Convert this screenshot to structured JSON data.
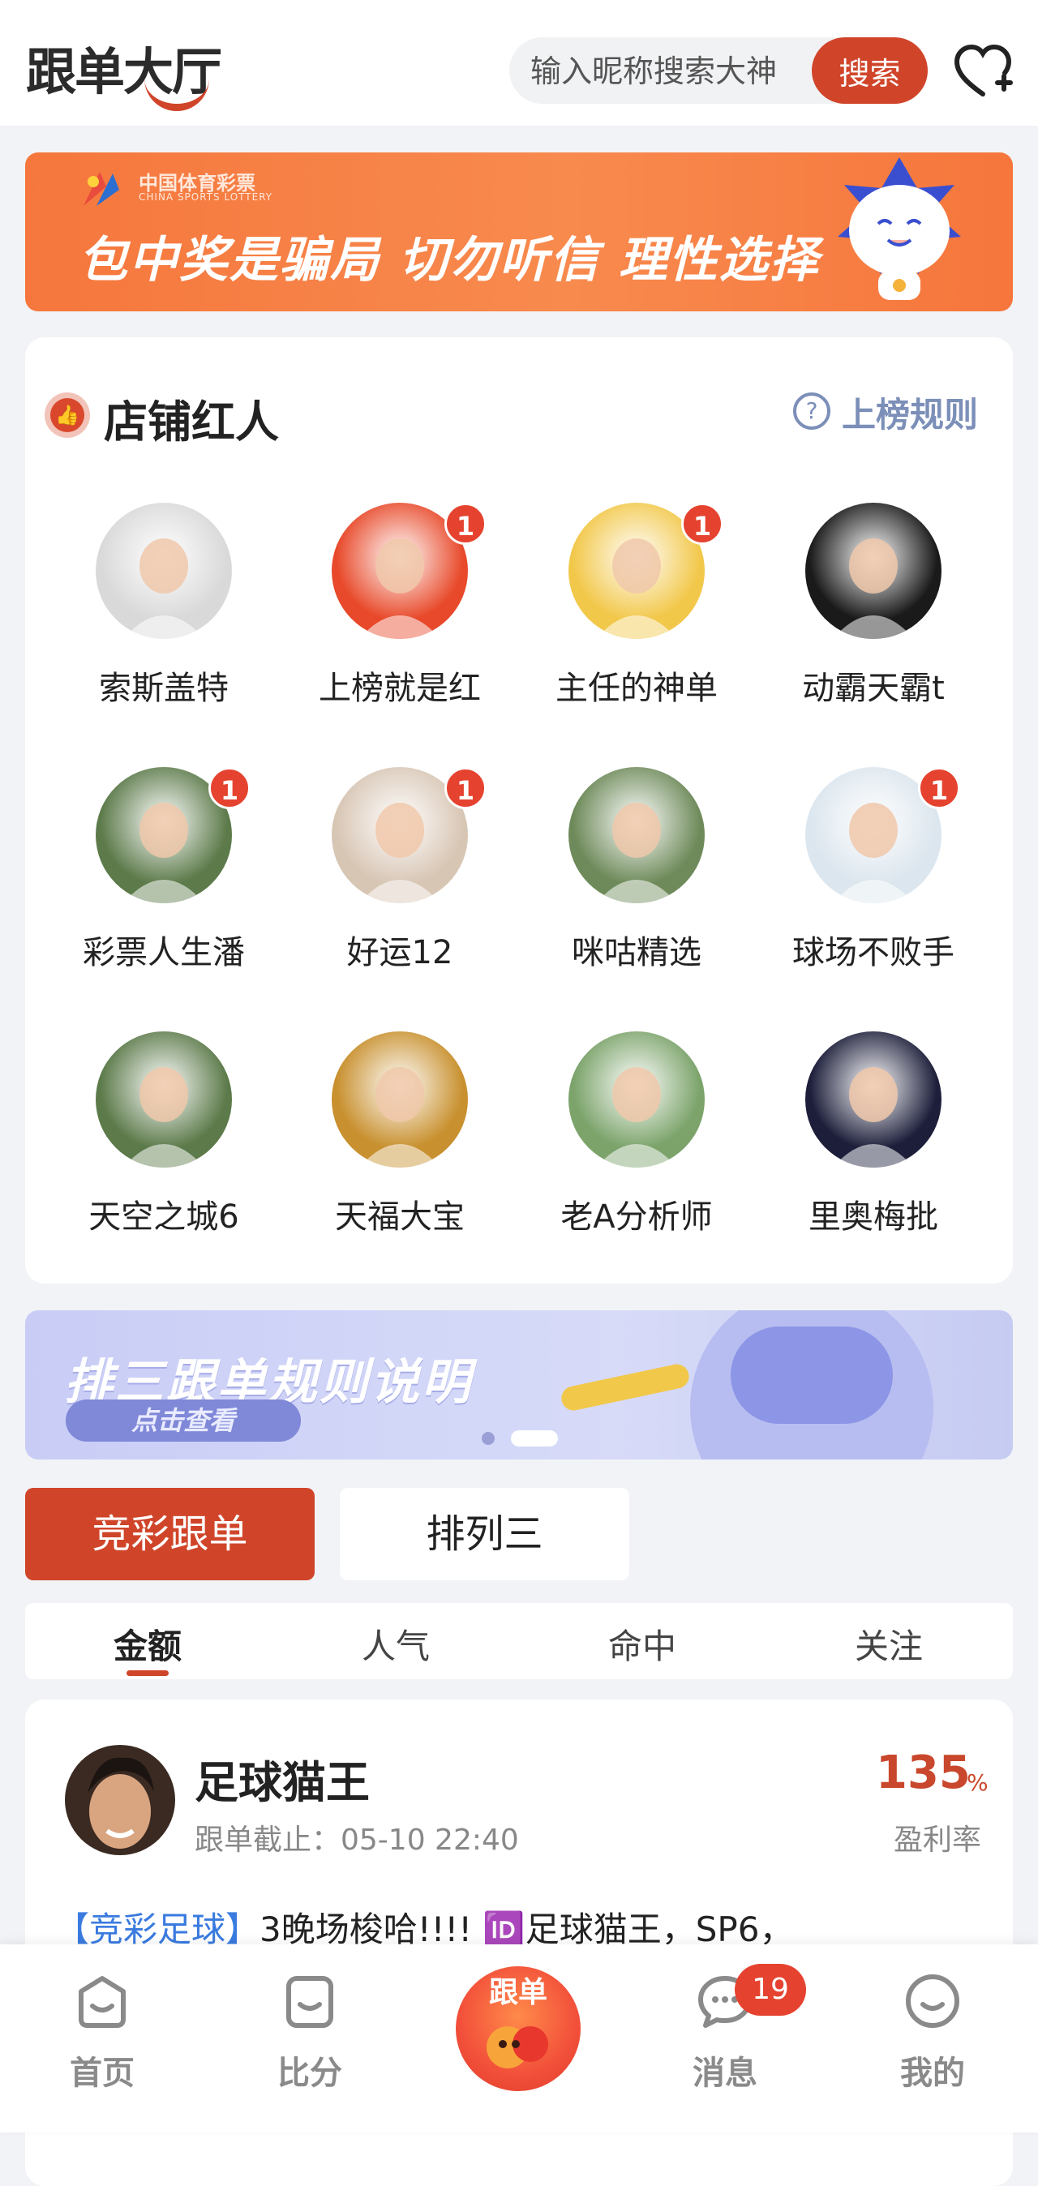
{
  "header": {
    "title": "跟单大厅",
    "search_placeholder": "输入昵称搜索大神",
    "search_button": "搜索"
  },
  "banner_top": {
    "brand_cn": "中国体育彩票",
    "brand_en": "CHINA SPORTS LOTTERY",
    "slogan": "包中奖是骗局 切勿听信 理性选择"
  },
  "hot_section": {
    "title": "店铺红人",
    "rules_link": "上榜规则",
    "users": [
      {
        "name": "索斯盖特",
        "badge": "",
        "color": "#D9D9D9"
      },
      {
        "name": "上榜就是红",
        "badge": "1",
        "color": "#E8492A"
      },
      {
        "name": "主任的神单",
        "badge": "1",
        "color": "#F2C84B"
      },
      {
        "name": "动霸天霸t",
        "badge": "",
        "color": "#1A1A1A"
      },
      {
        "name": "彩票人生潘",
        "badge": "1",
        "color": "#5C7A4A"
      },
      {
        "name": "好运12",
        "badge": "1",
        "color": "#D8C6B5"
      },
      {
        "name": "咪咕精选",
        "badge": "",
        "color": "#6E8A5A"
      },
      {
        "name": "球场不败手",
        "badge": "1",
        "color": "#DCE6EE"
      },
      {
        "name": "天空之城6",
        "badge": "",
        "color": "#5C7A4A"
      },
      {
        "name": "天福大宝",
        "badge": "",
        "color": "#C8902E"
      },
      {
        "name": "老A分析师",
        "badge": "",
        "color": "#7BA36A"
      },
      {
        "name": "里奥梅批",
        "badge": "",
        "color": "#1C1E3A"
      }
    ]
  },
  "banner_rules": {
    "title": "排三跟单规则说明",
    "button": "点击查看"
  },
  "tabs": {
    "active": "竞彩跟单",
    "inactive": "排列三"
  },
  "sort": {
    "items": [
      "金额",
      "人气",
      "命中",
      "关注"
    ],
    "active_index": 0
  },
  "post": {
    "name": "足球猫王",
    "deadline": "跟单截止：05-10 22:40",
    "profit_value": "135",
    "profit_unit": "%",
    "profit_label": "盈利率",
    "tag": "【竞彩足球】",
    "content": "3晚场梭哈!!!! 🆔足球猫王，SP6，"
  },
  "bottom_nav": {
    "items": [
      {
        "label": "首页",
        "icon": "home-icon"
      },
      {
        "label": "比分",
        "icon": "score-icon"
      },
      {
        "label": "跟单",
        "icon": "follow-center-icon"
      },
      {
        "label": "消息",
        "icon": "message-icon",
        "badge": "19"
      },
      {
        "label": "我的",
        "icon": "profile-icon"
      }
    ]
  },
  "colors": {
    "brand": "#D0452A",
    "rules_link": "#7C8FB8",
    "tag": "#3A7BE0"
  }
}
